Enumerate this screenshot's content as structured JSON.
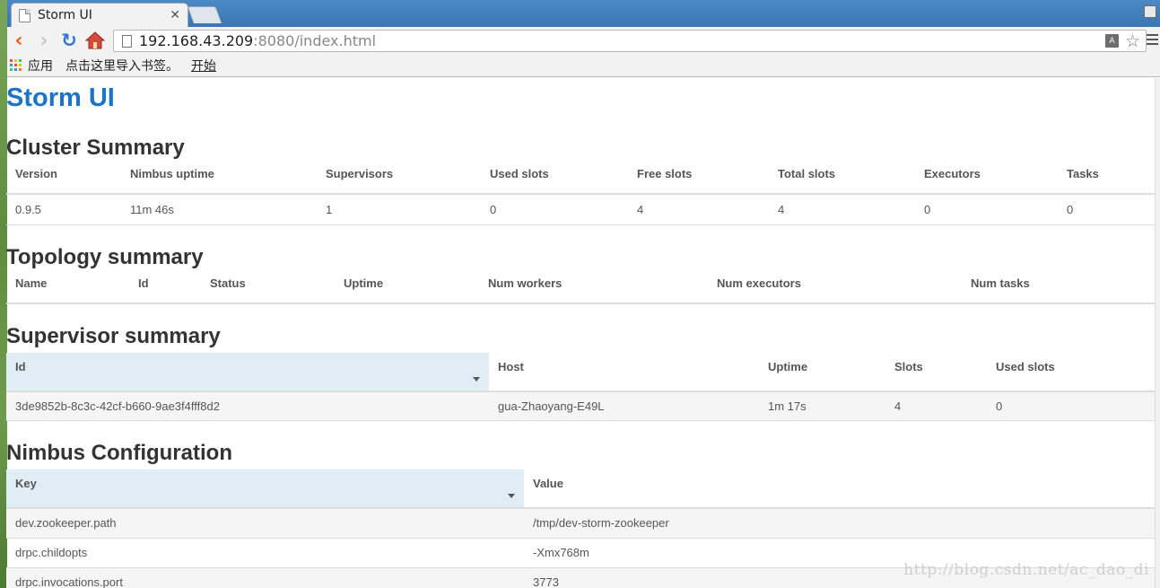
{
  "browser": {
    "tab_title": "Storm UI",
    "tab_close_glyph": "✕",
    "url_host": "192.168.43.209",
    "url_rest": ":8080/index.html",
    "bookmarks": {
      "apps_label": "应用",
      "hint_label": "点击这里导入书签。",
      "start_label": "开始"
    }
  },
  "page": {
    "title": "Storm UI",
    "cluster_summary": {
      "heading": "Cluster Summary",
      "columns": [
        "Version",
        "Nimbus uptime",
        "Supervisors",
        "Used slots",
        "Free slots",
        "Total slots",
        "Executors",
        "Tasks"
      ],
      "rows": [
        [
          "0.9.5",
          "11m 46s",
          "1",
          "0",
          "4",
          "4",
          "0",
          "0"
        ]
      ]
    },
    "topology_summary": {
      "heading": "Topology summary",
      "columns": [
        "Name",
        "Id",
        "Status",
        "Uptime",
        "Num workers",
        "Num executors",
        "Num tasks"
      ]
    },
    "supervisor_summary": {
      "heading": "Supervisor summary",
      "columns": [
        "Id",
        "Host",
        "Uptime",
        "Slots",
        "Used slots"
      ],
      "rows": [
        [
          "3de9852b-8c3c-42cf-b660-9ae3f4fff8d2",
          "gua-Zhaoyang-E49L",
          "1m 17s",
          "4",
          "0"
        ]
      ]
    },
    "nimbus_configuration": {
      "heading": "Nimbus Configuration",
      "columns": [
        "Key",
        "Value"
      ],
      "rows": [
        [
          "dev.zookeeper.path",
          "/tmp/dev-storm-zookeeper"
        ],
        [
          "drpc.childopts",
          "-Xmx768m"
        ],
        [
          "drpc.invocations.port",
          "3773"
        ]
      ]
    },
    "watermark": "http://blog.csdn.net/ac_dao_di"
  },
  "colors": {
    "title_blue": "#1c74c9",
    "sorted_header_bg": "#e1edf5",
    "stripe_bg": "#f5f5f5"
  }
}
